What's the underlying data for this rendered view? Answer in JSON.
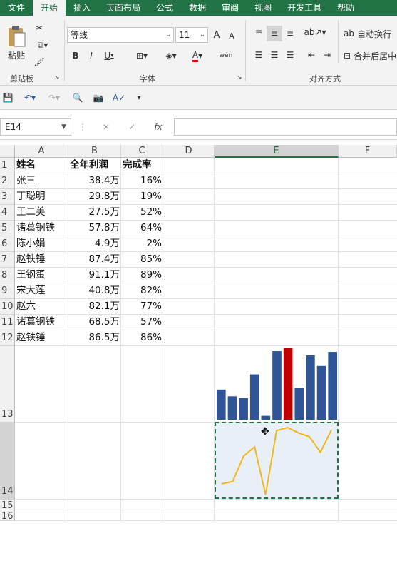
{
  "tabs": [
    "文件",
    "开始",
    "插入",
    "页面布局",
    "公式",
    "数据",
    "审阅",
    "视图",
    "开发工具",
    "帮助"
  ],
  "active_tab": "开始",
  "ribbon": {
    "paste_label": "粘贴",
    "clipboard_group": "剪贴板",
    "font_group": "字体",
    "align_group": "对齐方式",
    "font_name": "等线",
    "font_size": "11",
    "bold": "B",
    "italic": "I",
    "underline": "U",
    "grow_font": "A",
    "shrink_font": "A",
    "phonetic": "wén",
    "wrap_text": "自动换行",
    "merge_center": "合并后居中"
  },
  "formula_bar": {
    "name_box": "E14",
    "fx": "fx",
    "formula": ""
  },
  "columns": [
    "A",
    "B",
    "C",
    "D",
    "E",
    "F"
  ],
  "rows": [
    "1",
    "2",
    "3",
    "4",
    "5",
    "6",
    "7",
    "8",
    "9",
    "10",
    "11",
    "12",
    "13",
    "14",
    "15",
    "16"
  ],
  "table": {
    "headers": [
      "姓名",
      "全年利润",
      "完成率"
    ],
    "rows": [
      [
        "张三",
        "38.4万",
        "16%"
      ],
      [
        "丁聪明",
        "29.8万",
        "19%"
      ],
      [
        "王二美",
        "27.5万",
        "52%"
      ],
      [
        "诸葛钢铁",
        "57.8万",
        "64%"
      ],
      [
        "陈小娟",
        "4.9万",
        "2%"
      ],
      [
        "赵铁锤",
        "87.4万",
        "85%"
      ],
      [
        "王钢蛋",
        "91.1万",
        "89%"
      ],
      [
        "宋大莲",
        "40.8万",
        "82%"
      ],
      [
        "赵六",
        "82.1万",
        "77%"
      ],
      [
        "诸葛钢铁",
        "68.5万",
        "57%"
      ],
      [
        "赵铁锤",
        "86.5万",
        "86%"
      ]
    ]
  },
  "colors": {
    "accent": "#217346",
    "bar": "#2f5597",
    "bar_highlight": "#c00000",
    "line": "#f0b61d",
    "sparkline_bg": "#e9eff7"
  },
  "chart_data": [
    {
      "type": "bar",
      "categories": [
        "张三",
        "丁聪明",
        "王二美",
        "诸葛钢铁",
        "陈小娟",
        "赵铁锤",
        "王钢蛋",
        "宋大莲",
        "赵六",
        "诸葛钢铁",
        "赵铁锤"
      ],
      "values": [
        38.4,
        29.8,
        27.5,
        57.8,
        4.9,
        87.4,
        91.1,
        40.8,
        82.1,
        68.5,
        86.5
      ],
      "highlight_index": 6
    },
    {
      "type": "line",
      "categories": [
        "张三",
        "丁聪明",
        "王二美",
        "诸葛钢铁",
        "陈小娟",
        "赵铁锤",
        "王钢蛋",
        "宋大莲",
        "赵六",
        "诸葛钢铁",
        "赵铁锤"
      ],
      "values": [
        16,
        19,
        52,
        64,
        2,
        85,
        89,
        82,
        77,
        57,
        86
      ]
    }
  ]
}
